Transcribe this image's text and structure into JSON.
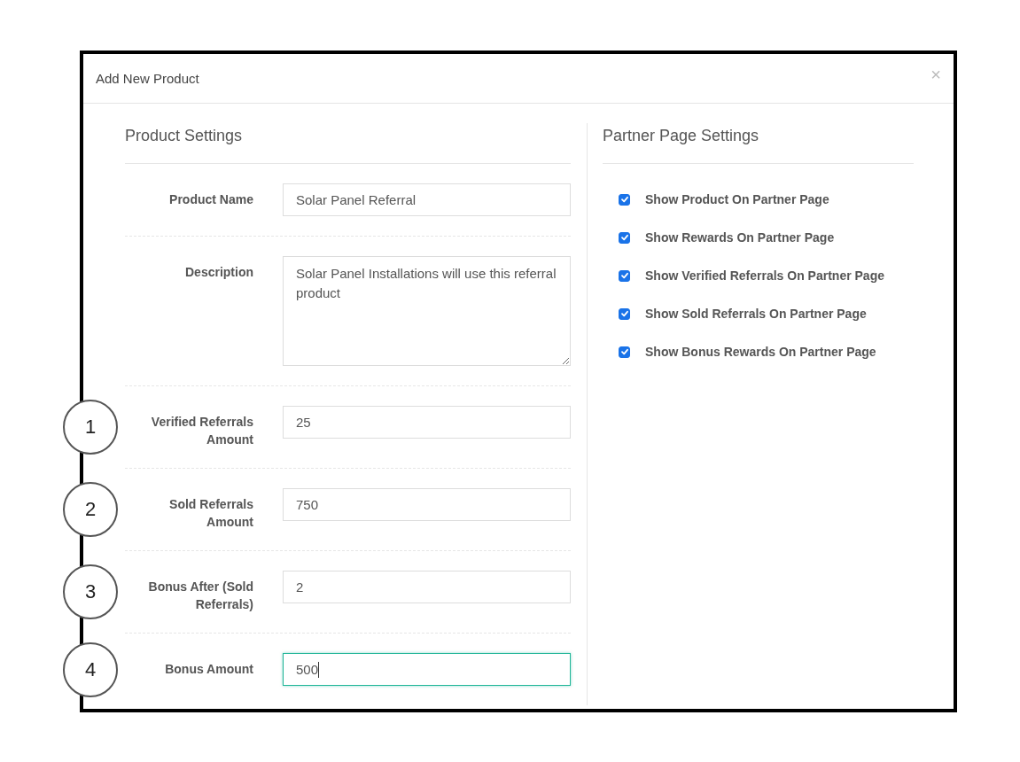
{
  "dialog": {
    "title": "Add New Product",
    "close": "×"
  },
  "product_settings": {
    "heading": "Product Settings",
    "fields": [
      {
        "label": "Product Name",
        "kind": "text",
        "value": "Solar Panel Referral",
        "focused": false
      },
      {
        "label": "Description",
        "kind": "textarea",
        "value": "Solar Panel Installations will use this referral product",
        "focused": false
      },
      {
        "label": "Verified Referrals Amount",
        "kind": "text",
        "value": "25",
        "focused": false,
        "callout": "1"
      },
      {
        "label": "Sold Referrals Amount",
        "kind": "text",
        "value": "750",
        "focused": false,
        "callout": "2"
      },
      {
        "label": "Bonus After (Sold Referrals)",
        "kind": "text",
        "value": "2",
        "focused": false,
        "callout": "3"
      },
      {
        "label": "Bonus Amount",
        "kind": "text",
        "value": "500",
        "focused": true,
        "callout": "4"
      }
    ]
  },
  "partner_page_settings": {
    "heading": "Partner Page Settings",
    "options": [
      {
        "label": "Show Product On Partner Page",
        "checked": true
      },
      {
        "label": "Show Rewards On Partner Page",
        "checked": true
      },
      {
        "label": "Show Verified Referrals On Partner Page",
        "checked": true
      },
      {
        "label": "Show Sold Referrals On Partner Page",
        "checked": true
      },
      {
        "label": "Show Bonus Rewards On Partner Page",
        "checked": true
      }
    ]
  }
}
